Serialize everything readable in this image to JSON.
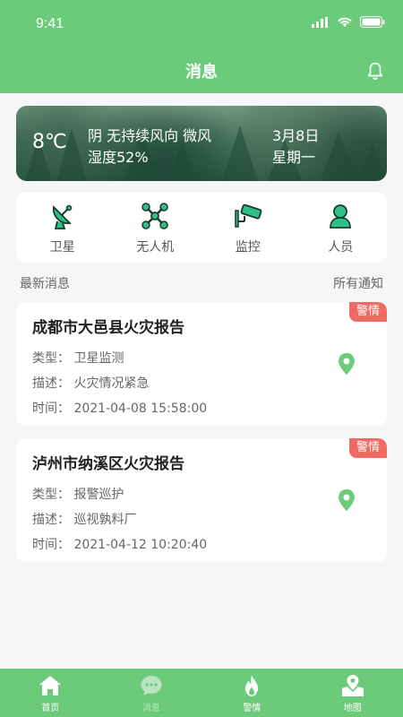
{
  "status_bar": {
    "time": "9:41"
  },
  "header": {
    "title": "消息"
  },
  "weather": {
    "temperature": "8℃",
    "description": "阴 无持续风向 微风",
    "humidity": "湿度52%",
    "date": "3月8日",
    "weekday": "星期一"
  },
  "categories": [
    {
      "label": "卫星",
      "icon": "satellite-dish-icon"
    },
    {
      "label": "无人机",
      "icon": "drone-icon"
    },
    {
      "label": "监控",
      "icon": "cctv-camera-icon"
    },
    {
      "label": "人员",
      "icon": "person-icon"
    }
  ],
  "section": {
    "left": "最新消息",
    "right": "所有通知"
  },
  "messages": [
    {
      "title": "成都市大邑县火灾报告",
      "badge": "警情",
      "type": "类型：  卫星监测",
      "desc": "描述：  火灾情况紧急",
      "time": "时间：  2021-04-08 15:58:00"
    },
    {
      "title": "泸州市纳溪区火灾报告",
      "badge": "警情",
      "type": "类型：  报警巡护",
      "desc": "描述：  巡视孰料厂",
      "time": "时间：  2021-04-12 10:20:40"
    }
  ],
  "tabbar": [
    {
      "label": "首页",
      "icon": "home-icon",
      "active": false
    },
    {
      "label": "消息",
      "icon": "chat-icon",
      "active": true
    },
    {
      "label": "警情",
      "icon": "fire-icon",
      "active": false
    },
    {
      "label": "地图",
      "icon": "map-icon",
      "active": false
    }
  ],
  "colors": {
    "primary": "#6ccb7a",
    "badge": "#f06a63",
    "icon_teal": "#2fc08a"
  }
}
